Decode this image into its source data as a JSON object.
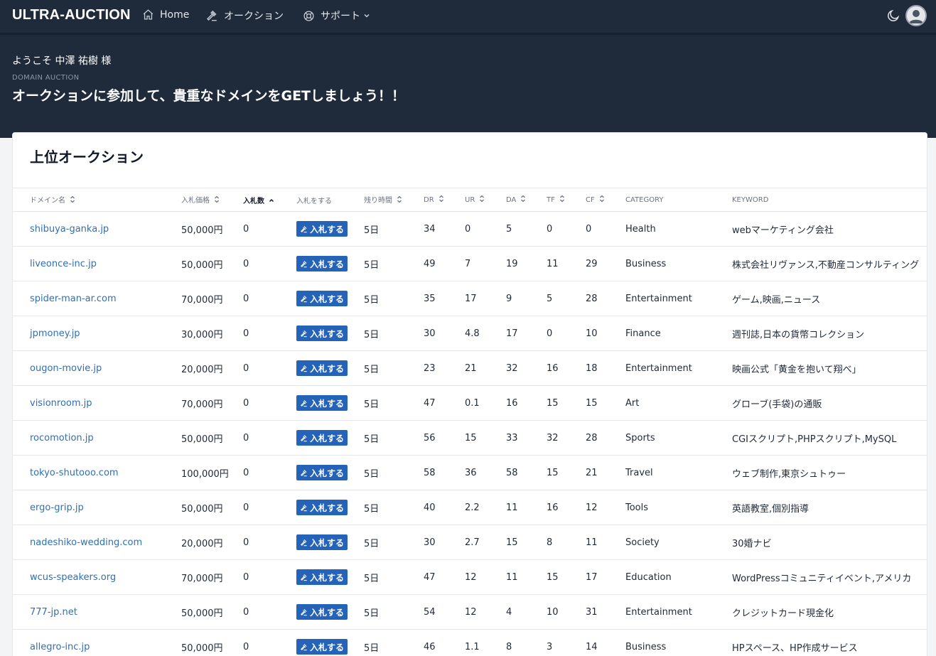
{
  "nav": {
    "brand": "ULTRA-AUCTION",
    "home": "Home",
    "auction": "オークション",
    "support": "サポート"
  },
  "hero": {
    "welcome": "ようこそ 中澤 祐樹 様",
    "eyebrow": "DOMAIN AUCTION",
    "headline": "オークションに参加して、貴重なドメインをGETしましょう！！"
  },
  "card": {
    "title": "上位オークション"
  },
  "table": {
    "headers": [
      {
        "label": "ドメイン名",
        "sort": "both"
      },
      {
        "label": "入札価格",
        "sort": "both"
      },
      {
        "label": "入札数",
        "sort": "up"
      },
      {
        "label": "入札をする",
        "sort": "none"
      },
      {
        "label": "残り時間",
        "sort": "both"
      },
      {
        "label": "DR",
        "sort": "both"
      },
      {
        "label": "UR",
        "sort": "both"
      },
      {
        "label": "DA",
        "sort": "both"
      },
      {
        "label": "TF",
        "sort": "both"
      },
      {
        "label": "CF",
        "sort": "both"
      },
      {
        "label": "CATEGORY",
        "sort": "none"
      },
      {
        "label": "KEYWORD",
        "sort": "none"
      }
    ],
    "bid_button_label": "入札する",
    "rows": [
      {
        "domain": "shibuya-ganka.jp",
        "price": "50,000円",
        "bids": "0",
        "time": "5日",
        "dr": "34",
        "ur": "0",
        "da": "5",
        "tf": "0",
        "cf": "0",
        "category": "Health",
        "keyword": "webマーケティング会社"
      },
      {
        "domain": "liveonce-inc.jp",
        "price": "50,000円",
        "bids": "0",
        "time": "5日",
        "dr": "49",
        "ur": "7",
        "da": "19",
        "tf": "11",
        "cf": "29",
        "category": "Business",
        "keyword": "株式会社リヴァンス,不動産コンサルティング"
      },
      {
        "domain": "spider-man-ar.com",
        "price": "70,000円",
        "bids": "0",
        "time": "5日",
        "dr": "35",
        "ur": "17",
        "da": "9",
        "tf": "5",
        "cf": "28",
        "category": "Entertainment",
        "keyword": "ゲーム,映画,ニュース"
      },
      {
        "domain": "jpmoney.jp",
        "price": "30,000円",
        "bids": "0",
        "time": "5日",
        "dr": "30",
        "ur": "4.8",
        "da": "17",
        "tf": "0",
        "cf": "10",
        "category": "Finance",
        "keyword": "週刊誌,日本の貨幣コレクション"
      },
      {
        "domain": "ougon-movie.jp",
        "price": "20,000円",
        "bids": "0",
        "time": "5日",
        "dr": "23",
        "ur": "21",
        "da": "32",
        "tf": "16",
        "cf": "18",
        "category": "Entertainment",
        "keyword": "映画公式「黄金を抱いて翔べ」"
      },
      {
        "domain": "visionroom.jp",
        "price": "70,000円",
        "bids": "0",
        "time": "5日",
        "dr": "47",
        "ur": "0.1",
        "da": "16",
        "tf": "15",
        "cf": "15",
        "category": "Art",
        "keyword": "グローブ(手袋)の通販"
      },
      {
        "domain": "rocomotion.jp",
        "price": "50,000円",
        "bids": "0",
        "time": "5日",
        "dr": "56",
        "ur": "15",
        "da": "33",
        "tf": "32",
        "cf": "28",
        "category": "Sports",
        "keyword": "CGIスクリプト,PHPスクリプト,MySQL"
      },
      {
        "domain": "tokyo-shutooo.com",
        "price": "100,000円",
        "bids": "0",
        "time": "5日",
        "dr": "58",
        "ur": "36",
        "da": "58",
        "tf": "15",
        "cf": "21",
        "category": "Travel",
        "keyword": "ウェブ制作,東京シュトゥー"
      },
      {
        "domain": "ergo-grip.jp",
        "price": "50,000円",
        "bids": "0",
        "time": "5日",
        "dr": "40",
        "ur": "2.2",
        "da": "11",
        "tf": "16",
        "cf": "12",
        "category": "Tools",
        "keyword": "英語教室,個別指導"
      },
      {
        "domain": "nadeshiko-wedding.com",
        "price": "20,000円",
        "bids": "0",
        "time": "5日",
        "dr": "30",
        "ur": "2.7",
        "da": "15",
        "tf": "8",
        "cf": "11",
        "category": "Society",
        "keyword": "30婚ナビ"
      },
      {
        "domain": "wcus-speakers.org",
        "price": "70,000円",
        "bids": "0",
        "time": "5日",
        "dr": "47",
        "ur": "12",
        "da": "11",
        "tf": "15",
        "cf": "17",
        "category": "Education",
        "keyword": "WordPressコミュニティイベント,アメリカ"
      },
      {
        "domain": "777-jp.net",
        "price": "50,000円",
        "bids": "0",
        "time": "5日",
        "dr": "54",
        "ur": "12",
        "da": "4",
        "tf": "10",
        "cf": "31",
        "category": "Entertainment",
        "keyword": "クレジットカード現金化"
      },
      {
        "domain": "allegro-inc.jp",
        "price": "50,000円",
        "bids": "0",
        "time": "5日",
        "dr": "46",
        "ur": "1.1",
        "da": "8",
        "tf": "3",
        "cf": "14",
        "category": "Business",
        "keyword": "HPスペース、HP作成サービス"
      }
    ]
  }
}
